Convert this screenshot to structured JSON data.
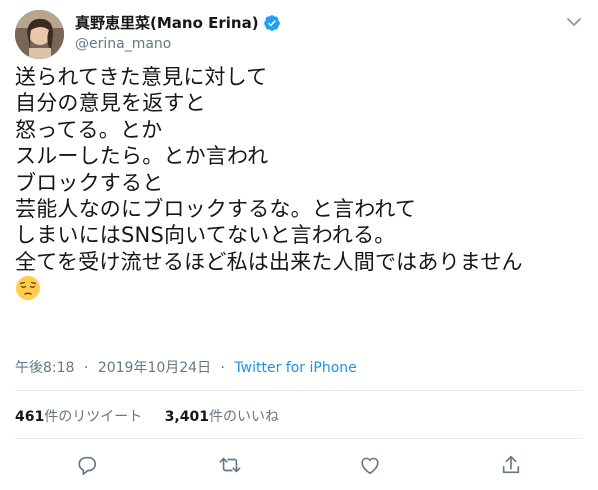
{
  "user": {
    "display_name": "真野恵里菜(Mano Erina)",
    "handle": "@erina_mano",
    "verified": true
  },
  "tweet": {
    "lines": [
      "送られてきた意見に対して",
      "自分の意見を返すと",
      "怒ってる。とか",
      "スルーしたら。とか言われ",
      "ブロックすると",
      "芸能人なのにブロックするな。と言われて",
      "しまいにはSNS向いてないと言われる。",
      "全てを受け流せるほど私は出来た人間ではありません"
    ],
    "emoji": "pensive-face",
    "time": "午後8:18",
    "separator": "·",
    "date": "2019年10月24日",
    "source": "Twitter for iPhone"
  },
  "stats": {
    "retweets_count": "461",
    "retweets_label": "件のリツイート",
    "likes_count": "3,401",
    "likes_label": "件のいいね"
  },
  "colors": {
    "text": "#14171a",
    "secondary": "#657786",
    "link": "#1b95e0",
    "divider": "#e6ecf0"
  },
  "icons": [
    "caret-down-icon",
    "verified-badge-icon",
    "reply-icon",
    "retweet-icon",
    "like-icon",
    "share-icon"
  ]
}
